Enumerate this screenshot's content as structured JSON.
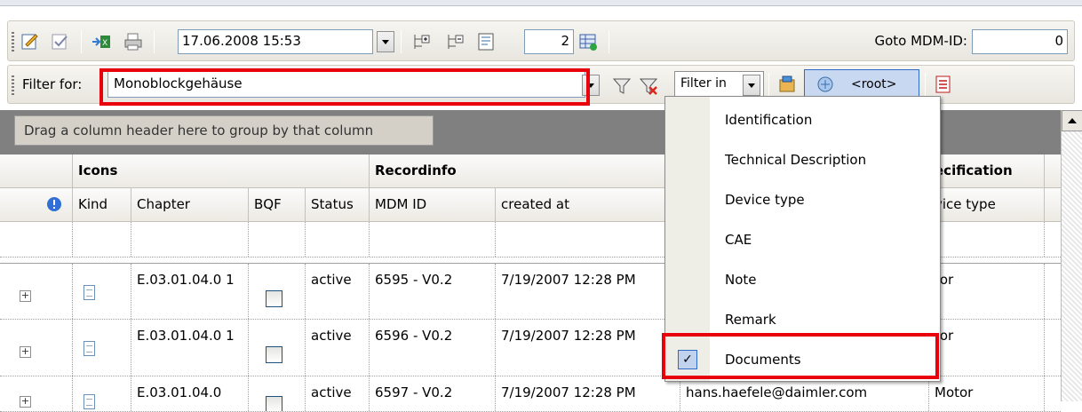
{
  "toolbar": {
    "datetime": "17.06.2008 15:53",
    "count_value": "2",
    "goto_label": "Goto MDM-ID:",
    "goto_value": "0"
  },
  "filterbar": {
    "filter_label": "Filter for:",
    "filter_value": "Monoblockgehäuse",
    "filter_in_label": "Filter in",
    "root_label": "<root>"
  },
  "grid": {
    "group_hint": "Drag a column header here to group by that column",
    "group_headers": {
      "icons": "Icons",
      "recordinfo": "Recordinfo",
      "specification": "ecification"
    },
    "columns": {
      "kind": "Kind",
      "chapter": "Chapter",
      "bqf": "BQF",
      "status": "Status",
      "mdm_id": "MDM ID",
      "created_at": "created at",
      "device_type": "vice type"
    },
    "rows": [
      {
        "chapter": "E.03.01.04.0 1",
        "status": "active",
        "mdm_id": "6595 - V0.2",
        "created_at": "7/19/2007 12:28 PM",
        "device": "tor"
      },
      {
        "chapter": "E.03.01.04.0 1",
        "status": "active",
        "mdm_id": "6596 - V0.2",
        "created_at": "7/19/2007 12:28 PM",
        "device": "tor"
      },
      {
        "chapter": "E.03.01.04.0",
        "status": "active",
        "mdm_id": "6597 - V0.2",
        "created_at": "7/19/2007 12:28 PM",
        "creator": "hans.haefele@daimler.com",
        "device": "Motor"
      }
    ]
  },
  "menu": {
    "items": [
      {
        "label": "Identification",
        "checked": false
      },
      {
        "label": "Technical Description",
        "checked": false
      },
      {
        "label": "Device type",
        "checked": false
      },
      {
        "label": "CAE",
        "checked": false
      },
      {
        "label": "Note",
        "checked": false
      },
      {
        "label": "Remark",
        "checked": false
      },
      {
        "label": "Documents",
        "checked": true
      }
    ],
    "checkmark": "✓"
  },
  "colors": {
    "highlight": "#e8000a",
    "header_bg": "#eceae3",
    "group_bar": "#808080"
  }
}
